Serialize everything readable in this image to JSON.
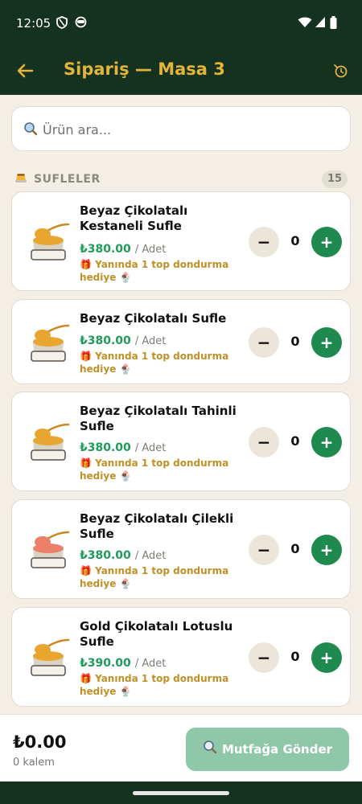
{
  "status_bar": {
    "time": "12:05",
    "left_icons": [
      "shield-icon",
      "globe-icon"
    ],
    "right_icons": [
      "wifi-icon",
      "signal-icon",
      "battery-icon"
    ]
  },
  "app_bar": {
    "title": "Sipariş — Masa 3",
    "back_icon": "arrow-left-icon",
    "history_icon": "history-icon",
    "accent_color": "#e3b43c",
    "background_color": "#14321f"
  },
  "search": {
    "placeholder": "Ürün ara...",
    "value": "",
    "icon": "search-icon"
  },
  "section": {
    "icon": "flan-icon",
    "title": "SUFLELER",
    "count": "15"
  },
  "products": [
    {
      "name": "Beyaz Çikolatalı Kestaneli Sufle",
      "price": "₺380.00",
      "unit": "/ Adet",
      "promo": "🎁 Yanında 1 top dondurma hediye 🍨",
      "quantity": "0",
      "sauce_color": "#e8a530"
    },
    {
      "name": "Beyaz Çikolatalı Sufle",
      "price": "₺380.00",
      "unit": "/ Adet",
      "promo": "🎁 Yanında 1 top dondurma hediye 🍨",
      "quantity": "0",
      "sauce_color": "#e8a530"
    },
    {
      "name": "Beyaz Çikolatalı Tahinli Sufle",
      "price": "₺380.00",
      "unit": "/ Adet",
      "promo": "🎁 Yanında 1 top dondurma hediye 🍨",
      "quantity": "0",
      "sauce_color": "#e8a530"
    },
    {
      "name": "Beyaz Çikolatalı Çilekli Sufle",
      "price": "₺380.00",
      "unit": "/ Adet",
      "promo": "🎁 Yanında 1 top dondurma hediye 🍨",
      "quantity": "0",
      "sauce_color": "#ec7f6a"
    },
    {
      "name": "Gold Çikolatalı Lotuslu Sufle",
      "price": "₺390.00",
      "unit": "/ Adet",
      "promo": "🎁 Yanında 1 top dondurma hediye 🍨",
      "quantity": "0",
      "sauce_color": "#e8a530"
    }
  ],
  "qty_controls": {
    "minus": "−",
    "plus": "+"
  },
  "footer": {
    "total": "₺0.00",
    "items": "0 kalem",
    "send_label": "Mutfağa Gönder",
    "send_icon": "search-icon",
    "send_color": "#8fc8a9"
  }
}
